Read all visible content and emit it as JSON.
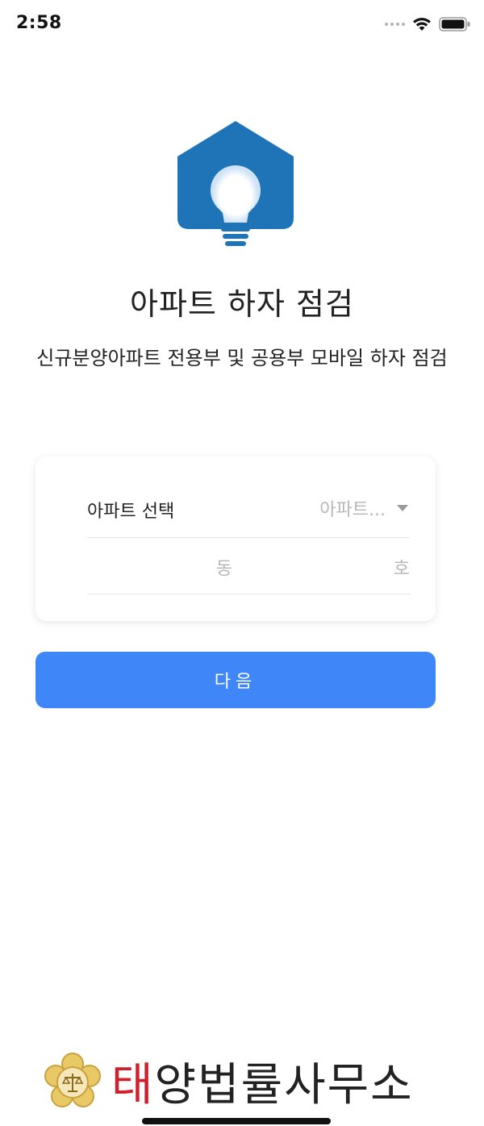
{
  "status_bar": {
    "time": "2:58"
  },
  "header": {
    "title": "아파트 하자 점검",
    "subtitle": "신규분양아파트 전용부 및 공용부 모바일 하자 점검"
  },
  "form": {
    "apt_label": "아파트 선택",
    "apt_select_value": "아파트...",
    "dong_placeholder": "동",
    "ho_placeholder": "호"
  },
  "actions": {
    "next_label": "다음"
  },
  "footer": {
    "brand_first": "태",
    "brand_rest": "양법률사무소"
  },
  "icons": {
    "app": "house-lightbulb-icon",
    "wifi": "wifi-icon",
    "battery": "battery-icon",
    "signal": "signal-dots-icon",
    "dropdown": "caret-down-icon",
    "emblem": "law-emblem-icon"
  },
  "colors": {
    "app_icon_blue": "#1f73b7",
    "primary_button": "#3f86f8",
    "brand_red": "#d0202b",
    "emblem_gold": "#c9a23f"
  }
}
